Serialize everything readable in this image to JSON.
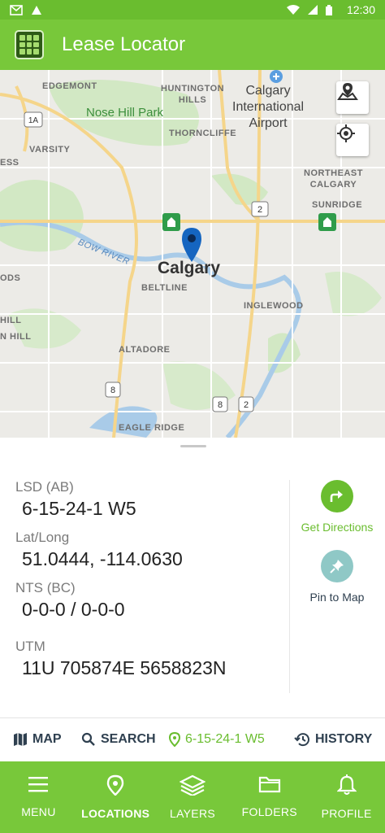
{
  "status_bar": {
    "time": "12:30"
  },
  "app_bar": {
    "title": "Lease Locator"
  },
  "map": {
    "labels": {
      "edgemont": "EDGEMONT",
      "huntington_hills": "HUNTINGTON\nHILLS",
      "nose_hill_park": "Nose Hill Park",
      "airport": "Calgary\nInternational\nAirport",
      "thorncliffe": "THORNCLIFFE",
      "varsity": "VARSITY",
      "northeast_calgary": "NORTHEAST\nCALGARY",
      "sunridge": "SUNRIDGE",
      "ess": "ESS",
      "bow_river": "Bow River",
      "calgary": "Calgary",
      "beltline": "BELTLINE",
      "ods": "ODS",
      "inglewood": "INGLEWOOD",
      "hill": "HILL",
      "nhill": "N HILL",
      "altadore": "ALTADORE",
      "eagle_ridge": "EAGLE RIDGE"
    },
    "shields": {
      "hwy_2_a": "2",
      "hwy_1a": "1A",
      "hwy_8_a": "8",
      "hwy_8_b": "8",
      "hwy_2_b": "2"
    }
  },
  "details": {
    "lsd_label": "LSD (AB)",
    "lsd_value": "6-15-24-1 W5",
    "latlong_label": "Lat/Long",
    "latlong_value": "51.0444, -114.0630",
    "nts_label": "NTS (BC)",
    "nts_value": "0-0-0 / 0-0-0",
    "utm_label": "UTM",
    "utm_value": "11U 705874E 5658823N"
  },
  "actions": {
    "get_directions": "Get Directions",
    "pin_to_map": "Pin to Map"
  },
  "tabs": {
    "map": "MAP",
    "search": "SEARCH",
    "current": "6-15-24-1 W5",
    "history": "HISTORY"
  },
  "bottom_nav": {
    "menu": "MENU",
    "locations": "LOCATIONS",
    "layers": "LAYERS",
    "folders": "FOLDERS",
    "profile": "PROFILE"
  },
  "colors": {
    "brand_green": "#78c83a",
    "accent_green": "#6abd2f",
    "pin_blue": "#1565c0",
    "pin_teal": "#8fc8c6"
  }
}
